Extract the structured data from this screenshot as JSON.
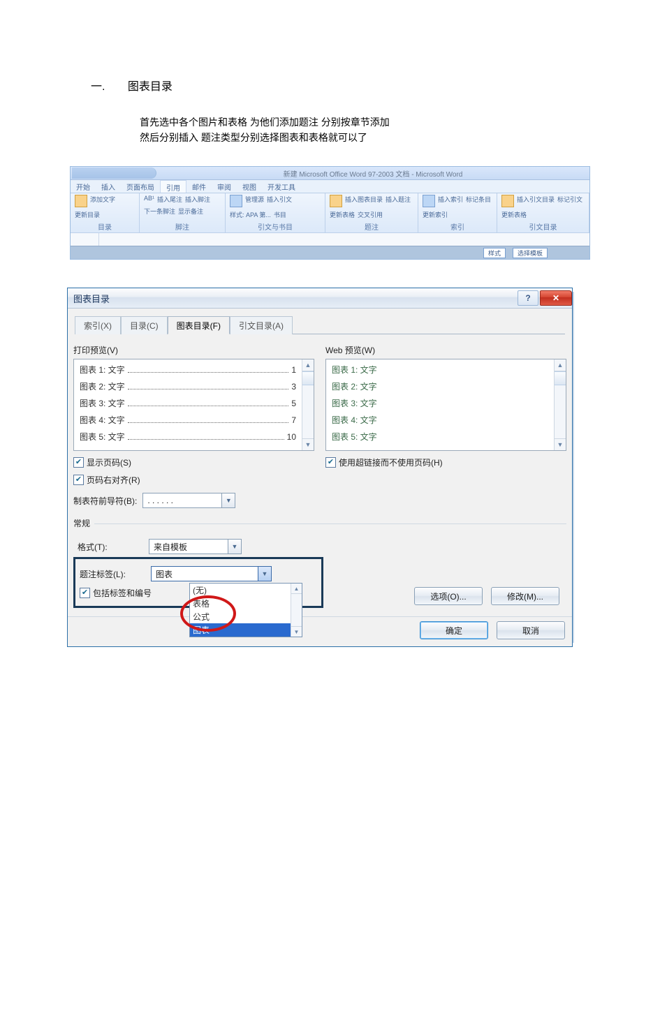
{
  "doc": {
    "heading_num": "一.",
    "heading_text": "图表目录",
    "para1": "首先选中各个图片和表格 为他们添加题注 分别按章节添加",
    "para2": "然后分别插入 题注类型分别选择图表和表格就可以了"
  },
  "ribbon": {
    "doc_title": "新建 Microsoft Office Word 97-2003 文档 - Microsoft Word",
    "tabs": [
      "开始",
      "插入",
      "页面布局",
      "引用",
      "邮件",
      "审阅",
      "视图",
      "开发工具"
    ],
    "active_tab": "引用",
    "groups": {
      "toc": {
        "label": "目录",
        "items": [
          "添加文字",
          "更新目录"
        ]
      },
      "footnote": {
        "label": "脚注",
        "items": [
          "AB¹",
          "插入脚注",
          "插入尾注",
          "下一条脚注",
          "显示备注"
        ]
      },
      "citation": {
        "label": "引文与书目",
        "items": [
          "插入引文",
          "管理源",
          "样式: APA 第...",
          "书目"
        ]
      },
      "caption": {
        "label": "题注",
        "items": [
          "插入题注",
          "插入图表目录",
          "更新表格",
          "交叉引用"
        ]
      },
      "index": {
        "label": "索引",
        "items": [
          "标记条目",
          "插入索引",
          "更新索引"
        ]
      },
      "auth": {
        "label": "引文目录",
        "items": [
          "标记引文",
          "插入引文目录",
          "更新表格"
        ]
      }
    },
    "footer_chips": [
      "样式",
      "选择模板"
    ]
  },
  "dialog": {
    "title": "图表目录",
    "tabs": {
      "index": "索引(X)",
      "toc": "目录(C)",
      "fig": "图表目录(F)",
      "auth": "引文目录(A)"
    },
    "print_preview_label": "打印预览(V)",
    "web_preview_label": "Web 预览(W)",
    "entries": [
      {
        "t": "图表 1: 文字",
        "p": "1"
      },
      {
        "t": "图表 2: 文字",
        "p": "3"
      },
      {
        "t": "图表 3: 文字",
        "p": "5"
      },
      {
        "t": "图表 4: 文字",
        "p": "7"
      },
      {
        "t": "图表 5: 文字",
        "p": "10"
      }
    ],
    "show_page_numbers": "显示页码(S)",
    "right_align": "页码右对齐(R)",
    "tab_leader_label": "制表符前导符(B):",
    "tab_leader_value": ". . . . . .",
    "use_hyperlinks": "使用超链接而不使用页码(H)",
    "general_legend": "常规",
    "format_label": "格式(T):",
    "format_value": "来自模板",
    "caption_label_label": "题注标签(L):",
    "caption_label_value": "图表",
    "include_label_num": "包括标签和编号",
    "dropdown_options": [
      "(无)",
      "表格",
      "公式",
      "图表"
    ],
    "dropdown_selected": "图表",
    "options_btn": "选项(O)...",
    "modify_btn": "修改(M)...",
    "ok_btn": "确定",
    "cancel_btn": "取消",
    "help_glyph": "?",
    "close_glyph": "✕"
  }
}
